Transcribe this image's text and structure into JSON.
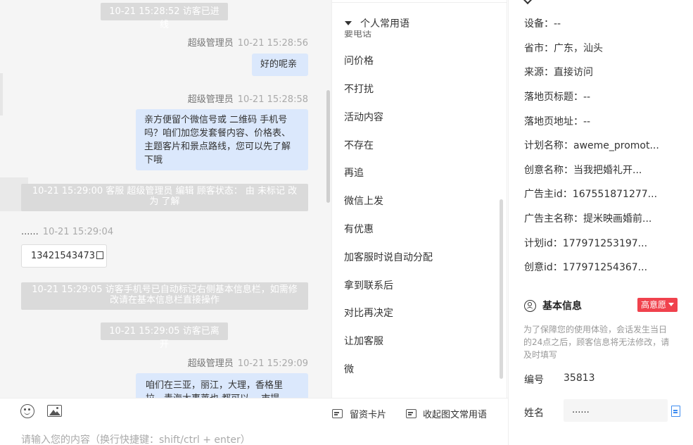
{
  "chat": {
    "sys1": "10-21 15:28:52 访客已进线",
    "msg1": {
      "sender": "超级管理员",
      "time": "10-21 15:28:56",
      "text": "好的呢亲"
    },
    "msg2": {
      "sender": "超级管理员",
      "time": "10-21 15:28:58",
      "lines": [
        "亲方便留个微信号或 二维码 手机号",
        "吗？咱们加您发套餐内容、价格表、",
        "主题客片和景点路线，您可以先了解",
        "下哦"
      ]
    },
    "sys2": {
      "line1": "10-21 15:29:00 客服 超级管理员 编辑 顾客状态： 由 未标记 改",
      "line2": "为 了解"
    },
    "visitor": {
      "name": "......",
      "time": "10-21 15:29:04",
      "phone": "13421543473"
    },
    "sys3": {
      "line1": "10-21 15:29:05 访客手机号已自动标记右侧基本信息栏，如需修",
      "line2": "改请在基本信息栏直接操作"
    },
    "sys4": "10-21 15:29:05 访客已离开",
    "msg3": {
      "sender": "超级管理员",
      "time": "10-21 15:29:09",
      "lines": [
        "咱们在三亚，丽江，大理，香格里",
        "拉，青海大事莱也 都可以… 市提"
      ]
    }
  },
  "menu": {
    "header": "个人常用语",
    "clipped": "要电话",
    "items": [
      "问价格",
      "不打扰",
      "活动内容",
      "不存在",
      "再追",
      "微信上发",
      "有优惠",
      "加客服时说自动分配",
      "拿到联系后",
      "对比再决定",
      "让加客服",
      "微"
    ]
  },
  "composer": {
    "card_label": "留资卡片",
    "collapse_label": "收起图文常用语",
    "placeholder": "请输入您的内容（换行快捷键：shift/ctrl + enter）"
  },
  "info": {
    "rows": [
      {
        "label": "设备：",
        "value": "--"
      },
      {
        "label": "省市：",
        "value": "广东，汕头"
      },
      {
        "label": "来源：",
        "value": "直接访问"
      },
      {
        "label": "落地页标题：",
        "value": "--"
      },
      {
        "label": "落地页地址：",
        "value": "--"
      },
      {
        "label": "计划名称：",
        "value": "aweme_promot..."
      },
      {
        "label": "创意名称：",
        "value": "当我把婚礼开..."
      },
      {
        "label": "广告主id：",
        "value": "167551871277..."
      },
      {
        "label": "广告主名称：",
        "value": "提米映画婚前..."
      },
      {
        "label": "计划id：",
        "value": "177971253197..."
      },
      {
        "label": "创意id：",
        "value": "177971254367..."
      }
    ],
    "section_title": "基本信息",
    "intent_badge": "高意愿",
    "notice_lines": [
      "为了保障您的使用体验，会话发生当日",
      "的24点之后，顾客信息将无法修改，请",
      "及时填写"
    ],
    "id_label": "编号",
    "id_value": "35813",
    "name_label": "姓名",
    "name_value": "......"
  },
  "colors": {
    "bubble": "#dbe8fc",
    "sys": "#dadada",
    "badge": "#f0424d",
    "accent": "#3e8cf0"
  }
}
